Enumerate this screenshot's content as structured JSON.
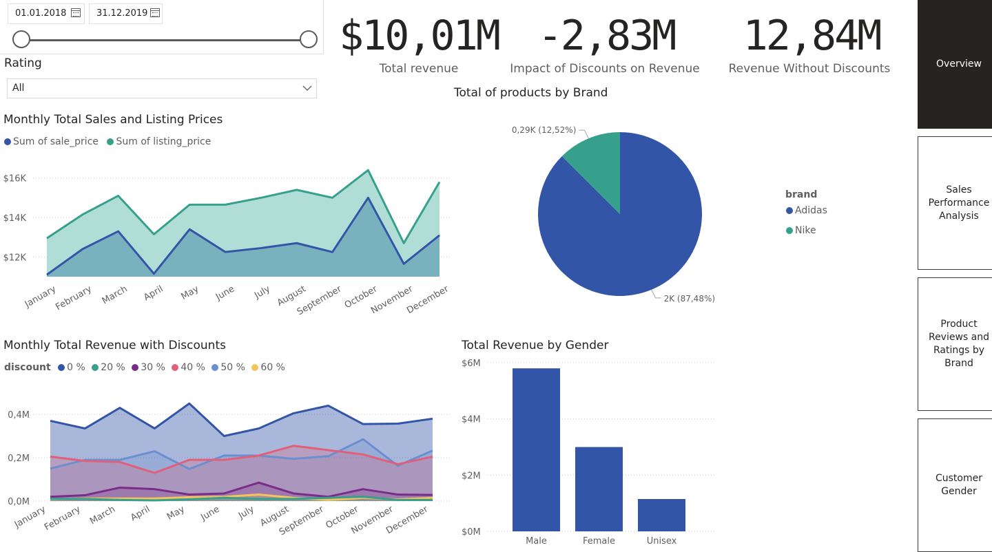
{
  "date_slicer": {
    "start": "01.01.2018",
    "end": "31.12.2019"
  },
  "rating_slicer": {
    "label": "Rating",
    "value": "All"
  },
  "kpis": [
    {
      "value": "$10,01M",
      "label": "Total revenue"
    },
    {
      "value": "-2,83M",
      "label": "Impact of Discounts on Revenue"
    },
    {
      "value": "12,84M",
      "label": "Revenue Without Discounts"
    }
  ],
  "nav": [
    {
      "label": "Overview",
      "active": true
    },
    {
      "label": "Sales Performance Analysis",
      "active": false
    },
    {
      "label": "Product Reviews and Ratings by Brand",
      "active": false
    },
    {
      "label": "Customer Gender",
      "active": false
    }
  ],
  "colors": {
    "blue": "#3355a8",
    "teal": "#36a08c",
    "purple": "#7a2c8a",
    "pink": "#e0607a",
    "lightblue": "#6a8fd0",
    "yellow": "#f2c45a"
  },
  "chart_data": [
    {
      "type": "area",
      "title": "Monthly Total Sales and Listing Prices",
      "categories": [
        "January",
        "February",
        "March",
        "April",
        "May",
        "June",
        "July",
        "August",
        "September",
        "October",
        "November",
        "December"
      ],
      "series": [
        {
          "name": "Sum of sale_price",
          "values": [
            11100,
            12400,
            13300,
            11150,
            13400,
            12250,
            12450,
            12700,
            12250,
            15000,
            11650,
            13100
          ]
        },
        {
          "name": "Sum of listing_price",
          "values": [
            12950,
            14150,
            15100,
            13150,
            14650,
            14650,
            15000,
            15400,
            15000,
            16400,
            12700,
            15800
          ]
        }
      ],
      "ylim": [
        11000,
        17000
      ],
      "yticks": [
        12000,
        14000,
        16000
      ],
      "ytick_labels": [
        "$12K",
        "$14K",
        "$16K"
      ],
      "grid": true,
      "legend": "top-left"
    },
    {
      "type": "pie",
      "title": "Total of products by Brand",
      "legend_title": "brand",
      "slices": [
        {
          "name": "Adidas",
          "value": 2000,
          "share": 87.48,
          "label": "2K (87,48%)"
        },
        {
          "name": "Nike",
          "value": 290,
          "share": 12.52,
          "label": "0,29K (12,52%)"
        }
      ],
      "legend": "right"
    },
    {
      "type": "area",
      "title": "Monthly Total Revenue with Discounts",
      "legend_title": "discount",
      "categories": [
        "January",
        "February",
        "March",
        "April",
        "May",
        "June",
        "July",
        "August",
        "September",
        "October",
        "November",
        "December"
      ],
      "series": [
        {
          "name": "0 %",
          "values": [
            0.37,
            0.335,
            0.43,
            0.335,
            0.45,
            0.3,
            0.335,
            0.405,
            0.44,
            0.355,
            0.357,
            0.38
          ]
        },
        {
          "name": "20 %",
          "values": [
            0.01,
            0.01,
            0.005,
            0.003,
            0.008,
            0.015,
            0.01,
            0.01,
            0.015,
            0.02,
            0.005,
            0.005
          ]
        },
        {
          "name": "30 %",
          "values": [
            0.02,
            0.027,
            0.062,
            0.055,
            0.03,
            0.035,
            0.085,
            0.035,
            0.02,
            0.055,
            0.03,
            0.028
          ]
        },
        {
          "name": "40 %",
          "values": [
            0.205,
            0.185,
            0.18,
            0.13,
            0.19,
            0.19,
            0.21,
            0.255,
            0.235,
            0.215,
            0.17,
            0.205
          ]
        },
        {
          "name": "50 %",
          "values": [
            0.15,
            0.19,
            0.19,
            0.23,
            0.148,
            0.21,
            0.21,
            0.195,
            0.207,
            0.285,
            0.163,
            0.233
          ]
        },
        {
          "name": "60 %",
          "values": [
            0.008,
            0.012,
            0.012,
            0.012,
            0.018,
            0.02,
            0.03,
            0.015,
            0.005,
            0.015,
            0.008,
            0.015
          ]
        }
      ],
      "ylim": [
        0,
        0.48
      ],
      "yticks": [
        0,
        0.2,
        0.4
      ],
      "ytick_labels": [
        "0,0M",
        "0,2M",
        "0,4M"
      ],
      "grid": true,
      "legend": "top-left"
    },
    {
      "type": "bar",
      "title": "Total Revenue by Gender",
      "categories": [
        "Male",
        "Female",
        "Unisex"
      ],
      "values": [
        5.8,
        3.0,
        1.15
      ],
      "ylim": [
        0,
        6
      ],
      "yticks": [
        0,
        2,
        4,
        6
      ],
      "ytick_labels": [
        "$0M",
        "$2M",
        "$4M",
        "$6M"
      ],
      "grid": true
    }
  ]
}
